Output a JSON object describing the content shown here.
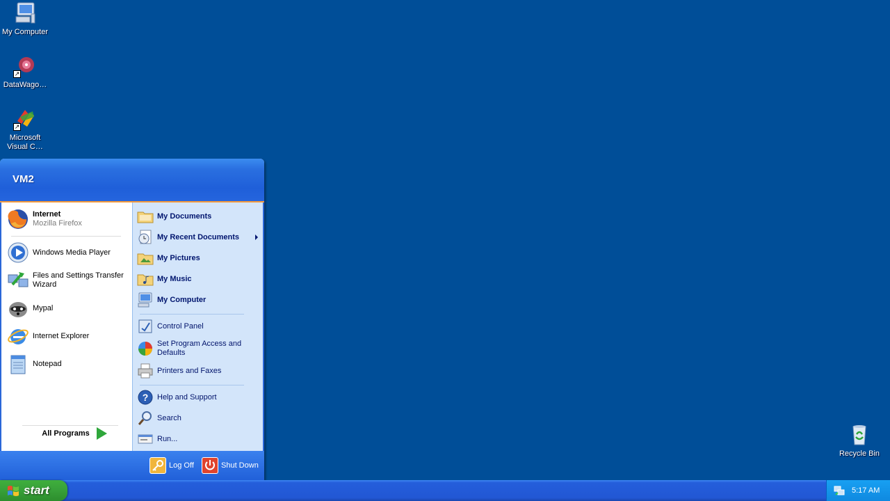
{
  "desktop": {
    "icons": [
      {
        "label": "My Computer",
        "icon": "computer-icon"
      },
      {
        "label": "DataWago…",
        "icon": "datawagon-icon"
      },
      {
        "label": "Microsoft\nVisual C…",
        "icon": "visual-c-icon"
      },
      {
        "label": "Recycle Bin",
        "icon": "recycle-bin-icon"
      }
    ]
  },
  "start_menu": {
    "user_name": "VM2",
    "left_items": [
      {
        "title": "Internet",
        "subtitle": "Mozilla Firefox",
        "icon": "firefox-icon"
      },
      {
        "title": "Windows Media Player",
        "icon": "media-player-icon"
      },
      {
        "title": "Files and Settings Transfer Wizard",
        "icon": "transfer-wizard-icon"
      },
      {
        "title": "Mypal",
        "icon": "mypal-icon"
      },
      {
        "title": "Internet Explorer",
        "icon": "ie-icon"
      },
      {
        "title": "Notepad",
        "icon": "notepad-icon"
      }
    ],
    "all_programs": "All Programs",
    "right_items": [
      {
        "label": "My Documents",
        "icon": "folder-icon",
        "bold": true
      },
      {
        "label": "My Recent Documents",
        "icon": "recent-docs-icon",
        "bold": true,
        "submenu": true
      },
      {
        "label": "My Pictures",
        "icon": "pictures-folder-icon",
        "bold": true
      },
      {
        "label": "My Music",
        "icon": "music-folder-icon",
        "bold": true
      },
      {
        "label": "My Computer",
        "icon": "computer-icon",
        "bold": true
      },
      {
        "label": "Control Panel",
        "icon": "control-panel-icon"
      },
      {
        "label": "Set Program Access and Defaults",
        "icon": "program-access-icon"
      },
      {
        "label": "Printers and Faxes",
        "icon": "printer-icon"
      },
      {
        "label": "Help and Support",
        "icon": "help-icon"
      },
      {
        "label": "Search",
        "icon": "search-icon"
      },
      {
        "label": "Run...",
        "icon": "run-icon"
      }
    ],
    "log_off": "Log Off",
    "shut_down": "Shut Down"
  },
  "taskbar": {
    "start_label": "start",
    "clock": "5:17 AM"
  },
  "colors": {
    "desktop": "#004e98",
    "start_green": "#39a33a",
    "menu_blue": "#245edb",
    "menu_right_bg": "#d3e5fa"
  }
}
